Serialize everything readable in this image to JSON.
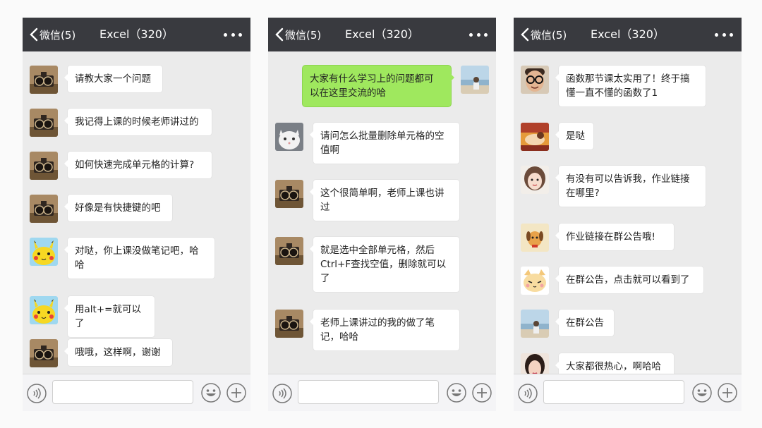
{
  "panels": [
    {
      "header": {
        "back_label": "微信(5)",
        "title": "Excel（320）"
      },
      "messages": [
        {
          "side": "left",
          "avatar": "vintage-camera",
          "lines": [
            "请教大家一个问题"
          ]
        },
        {
          "side": "left",
          "avatar": "vintage-camera",
          "lines": [
            "我记得上课的时候老师讲过的"
          ]
        },
        {
          "side": "left",
          "avatar": "vintage-camera",
          "lines": [
            "如何快速完成单元格的计算?"
          ]
        },
        {
          "side": "left",
          "avatar": "vintage-camera",
          "lines": [
            "好像是有快捷键的吧"
          ]
        },
        {
          "side": "left",
          "avatar": "pikachu",
          "lines": [
            "对哒，你上课没做笔记吧，哈",
            "哈"
          ]
        },
        {
          "side": "left",
          "avatar": "pikachu",
          "lines": [
            "用alt+=就可以了"
          ]
        },
        {
          "side": "left",
          "avatar": "vintage-camera",
          "lines": [
            "哦哦，这样啊，谢谢"
          ]
        }
      ]
    },
    {
      "header": {
        "back_label": "微信(5)",
        "title": "Excel（320）"
      },
      "messages": [
        {
          "side": "right",
          "avatar": "seaside-person",
          "lines": [
            "大家有什么学习上的问题都可",
            "以在这里交流的哈"
          ]
        },
        {
          "side": "left",
          "avatar": "white-cat",
          "lines": [
            "请问怎么批量删除单元格的空",
            "值啊"
          ]
        },
        {
          "side": "left",
          "avatar": "vintage-camera",
          "lines": [
            "这个很简单啊，老师上课也讲",
            "过"
          ]
        },
        {
          "side": "left",
          "avatar": "vintage-camera",
          "lines": [
            "就是选中全部单元格，然后",
            "Ctrl+F查找空值，删除就可以",
            "了"
          ]
        },
        {
          "side": "left",
          "avatar": "vintage-camera",
          "lines": [
            "老师上课讲过的我的做了笔",
            "记，哈哈"
          ]
        }
      ]
    },
    {
      "header": {
        "back_label": "微信(5)",
        "title": "Excel（320）"
      },
      "messages": [
        {
          "side": "left",
          "avatar": "glasses-man",
          "lines": [
            "函数那节课太实用了！终于搞",
            "懂一直不懂的函数了1"
          ]
        },
        {
          "side": "left",
          "avatar": "painting",
          "lines": [
            "是哒"
          ]
        },
        {
          "side": "left",
          "avatar": "girl-portrait",
          "lines": [
            "有没有可以告诉我，作业链接",
            "在哪里?"
          ]
        },
        {
          "side": "left",
          "avatar": "cartoon-dog",
          "lines": [
            "作业链接在群公告哦!"
          ]
        },
        {
          "side": "left",
          "avatar": "cartoon-cat",
          "lines": [
            "在群公告，点击就可以看到了"
          ]
        },
        {
          "side": "left",
          "avatar": "seaside-person",
          "lines": [
            "在群公告"
          ]
        },
        {
          "side": "left",
          "avatar": "woman-portrait",
          "lines": [
            "大家都很热心，啊哈哈"
          ]
        }
      ]
    }
  ],
  "input_bar": {
    "placeholder": ""
  },
  "colors": {
    "header_bg": "#393a3f",
    "chat_bg": "#ebebeb",
    "sent_bubble": "#9fe85e",
    "received_bubble": "#ffffff"
  }
}
